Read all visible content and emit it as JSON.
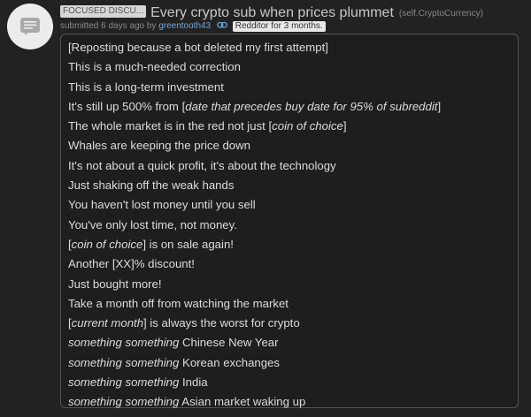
{
  "post": {
    "flair": "FOCUSED DISCU...",
    "title": "Every crypto sub when prices plummet",
    "domain": "(self.CryptoCurrency)",
    "submitted_prefix": "submitted",
    "time_ago": "6 days ago",
    "by": "by",
    "author": "greentooth43",
    "author_flair": "Redditor for 3 months.",
    "thumbnail_icon": "self-post-icon",
    "flair_icon": "link-icon"
  },
  "body_lines": [
    {
      "segments": [
        {
          "t": "[Reposting because a bot deleted my first attempt]",
          "i": false
        }
      ]
    },
    {
      "segments": [
        {
          "t": "This is a much-needed correction",
          "i": false
        }
      ]
    },
    {
      "segments": [
        {
          "t": "This is a long-term investment",
          "i": false
        }
      ]
    },
    {
      "segments": [
        {
          "t": "It's still up 500% from [",
          "i": false
        },
        {
          "t": "date that precedes buy date for 95% of subreddit",
          "i": true
        },
        {
          "t": "]",
          "i": false
        }
      ]
    },
    {
      "segments": [
        {
          "t": "The whole market is in the red not just [",
          "i": false
        },
        {
          "t": "coin of choice",
          "i": true
        },
        {
          "t": "]",
          "i": false
        }
      ]
    },
    {
      "segments": [
        {
          "t": "Whales are keeping the price down",
          "i": false
        }
      ]
    },
    {
      "segments": [
        {
          "t": "It's not about a quick profit, it's about the technology",
          "i": false
        }
      ]
    },
    {
      "segments": [
        {
          "t": "Just shaking off the weak hands",
          "i": false
        }
      ]
    },
    {
      "segments": [
        {
          "t": "You haven't lost money until you sell",
          "i": false
        }
      ]
    },
    {
      "segments": [
        {
          "t": "You've only lost time, not money.",
          "i": false
        }
      ]
    },
    {
      "segments": [
        {
          "t": "[",
          "i": false
        },
        {
          "t": "coin of choice",
          "i": true
        },
        {
          "t": "] is on sale again!",
          "i": false
        }
      ]
    },
    {
      "segments": [
        {
          "t": "Another [XX]% discount!",
          "i": false
        }
      ]
    },
    {
      "segments": [
        {
          "t": "Just bought more!",
          "i": false
        }
      ]
    },
    {
      "segments": [
        {
          "t": "Take a month off from watching the market",
          "i": false
        }
      ]
    },
    {
      "segments": [
        {
          "t": "[",
          "i": false
        },
        {
          "t": "current month",
          "i": true
        },
        {
          "t": "] is always the worst for crypto",
          "i": false
        }
      ]
    },
    {
      "segments": [
        {
          "t": "something something",
          "i": true
        },
        {
          "t": " Chinese New Year",
          "i": false
        }
      ]
    },
    {
      "segments": [
        {
          "t": "something something",
          "i": true
        },
        {
          "t": " Korean exchanges",
          "i": false
        }
      ]
    },
    {
      "segments": [
        {
          "t": "something something",
          "i": true
        },
        {
          "t": " India",
          "i": false
        }
      ]
    },
    {
      "segments": [
        {
          "t": "something something",
          "i": true
        },
        {
          "t": " Asian market waking up",
          "i": false
        }
      ]
    }
  ],
  "colors": {
    "background": "#222222",
    "body_background": "#1e1e1e",
    "author_link": "#6fa8dc"
  }
}
